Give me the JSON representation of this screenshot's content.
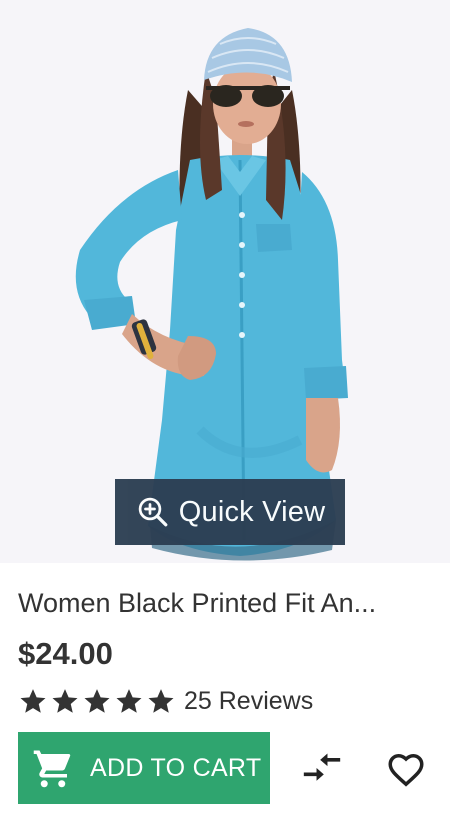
{
  "product": {
    "image_alt": "Girl in blue denim shirt dress with sunglasses and headscarf",
    "quick_view_label": "Quick View",
    "title": "Women Black Printed Fit An...",
    "price": "$24.00",
    "rating": 5,
    "reviews_label": "25 Reviews",
    "add_to_cart_label": "ADD TO CART"
  },
  "icons": {
    "quick_view": "zoom-in-icon",
    "cart": "shopping-cart-icon",
    "compare": "compare-arrows-icon",
    "wishlist": "heart-outline-icon",
    "star": "star-icon"
  },
  "colors": {
    "image_background": "#f6f5f9",
    "quick_view_background": "#2c3e52",
    "add_to_cart_background": "#2fa56f",
    "text": "#333333",
    "denim": "#4fb6d8"
  }
}
